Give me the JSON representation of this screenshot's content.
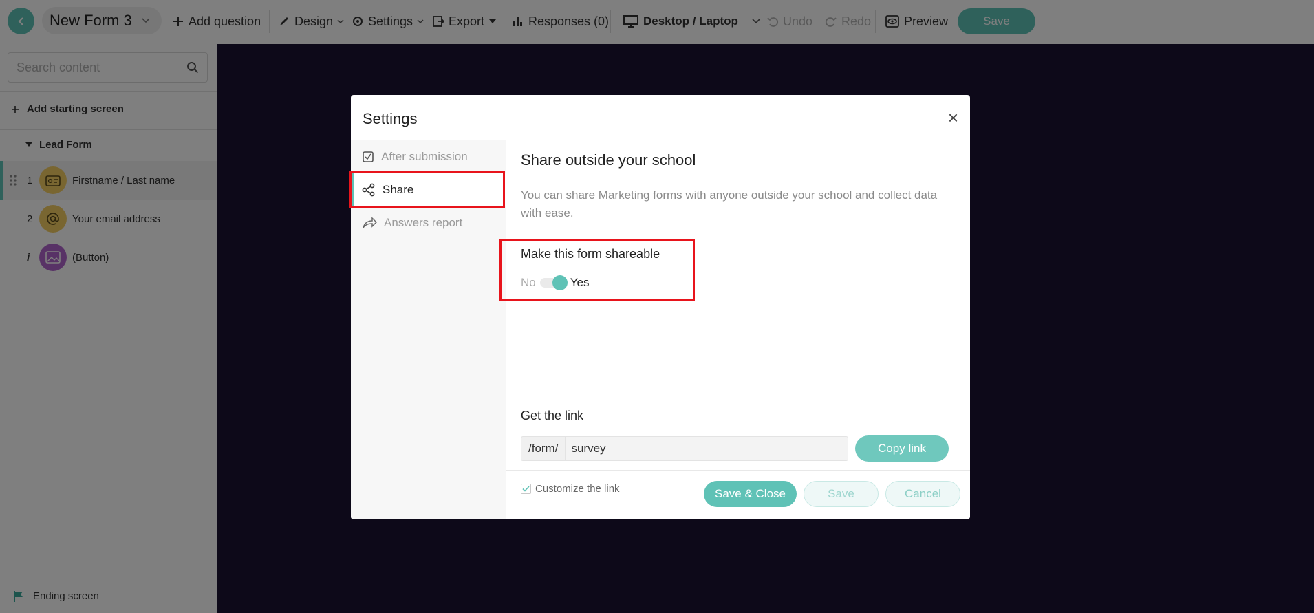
{
  "topbar": {
    "form_title": "New Form 3",
    "add_question": "Add question",
    "design": "Design",
    "settings": "Settings",
    "export": "Export",
    "responses": "Responses (0)",
    "device": "Desktop / Laptop",
    "undo": "Undo",
    "redo": "Redo",
    "preview": "Preview",
    "save": "Save"
  },
  "sidebar": {
    "search_placeholder": "Search content",
    "add_starting_screen": "Add starting screen",
    "section_title": "Lead Form",
    "items": [
      {
        "num": "1",
        "label": "Firstname / Last name"
      },
      {
        "num": "2",
        "label": "Your email address"
      },
      {
        "num": "i",
        "label": "(Button)"
      }
    ],
    "ending_screen": "Ending screen"
  },
  "modal": {
    "title": "Settings",
    "close": "×",
    "nav": [
      {
        "label": "After submission"
      },
      {
        "label": "Share"
      },
      {
        "label": "Answers report"
      }
    ],
    "share_heading": "Share outside your school",
    "description": "You can share Marketing forms with anyone outside your school and collect data with ease.",
    "shareable_heading": "Make this form shareable",
    "toggle_no": "No",
    "toggle_yes": "Yes",
    "get_link_heading": "Get the link",
    "link_prefix": "/form/",
    "link_value": "survey",
    "copy_link": "Copy link",
    "customize_link": "Customize the link",
    "footer": {
      "save_close": "Save & Close",
      "save": "Save",
      "cancel": "Cancel"
    }
  },
  "colors": {
    "accent": "#5fc2b6",
    "canvas": "#1a1233",
    "highlight": "#e8141c"
  }
}
